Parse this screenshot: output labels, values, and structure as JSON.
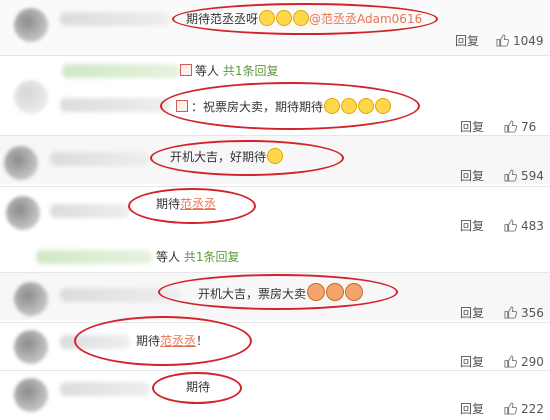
{
  "comments": [
    {
      "text": "期待范丞丞呀",
      "mention": "@范丞丞Adam0616",
      "reply": "回复",
      "likes": "1049"
    },
    {
      "prefix": "：",
      "text": "祝票房大卖，期待期待",
      "reply": "回复",
      "likes": "76"
    },
    {
      "text": "开机大吉，好期待",
      "reply": "回复",
      "likes": "594"
    },
    {
      "text_before": "期待",
      "name": "范丞丞",
      "reply": "回复",
      "likes": "483"
    },
    {
      "text": "开机大吉，票房大卖",
      "reply": "回复",
      "likes": "356"
    },
    {
      "text_before": "期待",
      "name": "范丞丞",
      "text_after": "！",
      "reply": "回复",
      "likes": "290"
    },
    {
      "text": "期待",
      "reply": "回复",
      "likes": "222"
    }
  ],
  "sub_replies": [
    {
      "suffix": "等人",
      "count": "共1条回复"
    },
    {
      "suffix": "等人",
      "count": "共1条回复"
    }
  ],
  "colors": {
    "highlight_ring": "#d2232a",
    "link": "#eb7350",
    "green": "#5c9a40"
  }
}
